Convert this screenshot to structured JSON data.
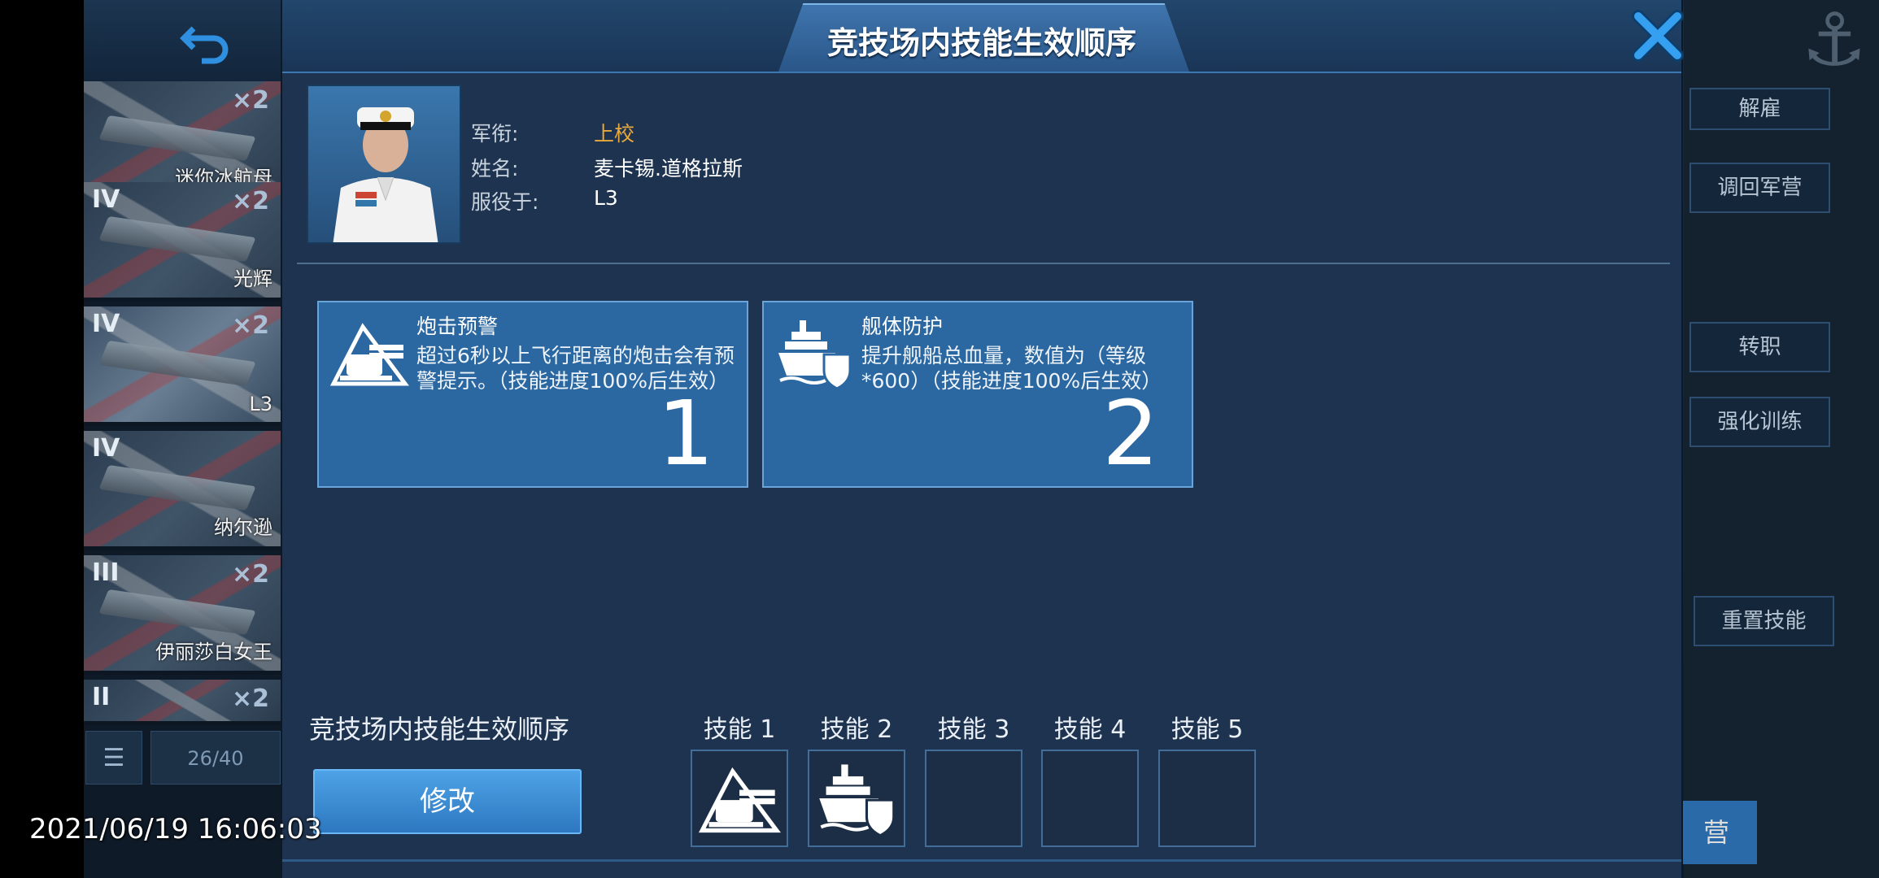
{
  "modal": {
    "title": "竞技场内技能生效顺序",
    "captain": {
      "rank_label": "军衔:",
      "rank_value": "上校",
      "name_label": "姓名:",
      "name_value": "麦卡锡.道格拉斯",
      "serving_label": "服役于:",
      "serving_value": "L3"
    },
    "skills": [
      {
        "icon": "artillery-turret-icon",
        "name": "炮击预警",
        "desc": "超过6秒以上飞行距离的炮击会有预警提示。（技能进度100%后生效）",
        "order": "1"
      },
      {
        "icon": "ship-shield-icon",
        "name": "舰体防护",
        "desc": "提升舰船总血量，数值为（等级*600）（技能进度100%后生效）",
        "order": "2"
      }
    ],
    "order_section_title": "竞技场内技能生效顺序",
    "modify_label": "修改",
    "slots": [
      {
        "label": "技能 1",
        "icon": "artillery-turret-icon"
      },
      {
        "label": "技能 2",
        "icon": "ship-shield-icon"
      },
      {
        "label": "技能 3",
        "icon": ""
      },
      {
        "label": "技能 4",
        "icon": ""
      },
      {
        "label": "技能 5",
        "icon": ""
      }
    ]
  },
  "background": {
    "ships": [
      {
        "tier": "",
        "count": "×2",
        "name": "迷你冰航母"
      },
      {
        "tier": "IV",
        "count": "×2",
        "name": "光辉"
      },
      {
        "tier": "IV",
        "count": "×2",
        "name": "L3"
      },
      {
        "tier": "IV",
        "count": "",
        "name": "纳尔逊"
      },
      {
        "tier": "III",
        "count": "×2",
        "name": "伊丽莎白女王"
      },
      {
        "tier": "II",
        "count": "×2",
        "name": ""
      }
    ],
    "capacity": "26/40",
    "right_buttons": [
      "解雇",
      "调回军营",
      "转职",
      "强化训练",
      "重置技能"
    ],
    "bottom_button_fragment": "营"
  },
  "timestamp": "2021/06/19 16:06:03",
  "colors": {
    "accent": "#2b67a0",
    "rank": "#e9a93b",
    "close": "#2f8fe0"
  }
}
